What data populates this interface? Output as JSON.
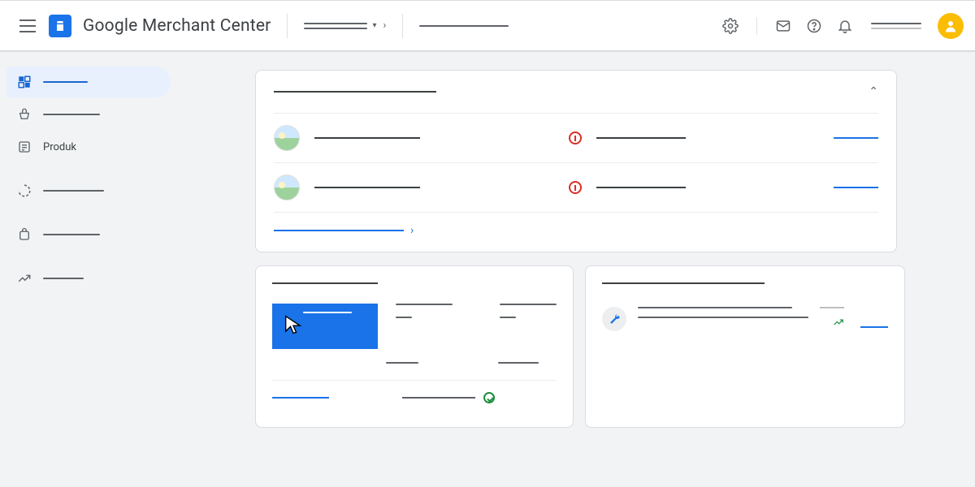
{
  "header": {
    "app_title": "Google Merchant Center",
    "account_selector": "",
    "secondary_selector": "",
    "user_label": ""
  },
  "sidebar": {
    "items": [
      {
        "id": "overview",
        "label": "",
        "active": true
      },
      {
        "id": "orders",
        "label": ""
      },
      {
        "id": "products",
        "label": "Produk"
      },
      {
        "id": "performance",
        "label": ""
      },
      {
        "id": "marketing",
        "label": ""
      },
      {
        "id": "growth",
        "label": ""
      }
    ]
  },
  "overview_card": {
    "title": "",
    "rows": [
      {
        "name": "",
        "status": "",
        "status_type": "error",
        "action": ""
      },
      {
        "name": "",
        "status": "",
        "status_type": "error",
        "action": ""
      }
    ],
    "footer_link": ""
  },
  "card_b": {
    "title": "",
    "highlighted": "",
    "footer": {
      "link": "",
      "text": "",
      "status": "approved"
    }
  },
  "card_c": {
    "title": "",
    "item": {
      "line1": "",
      "line2": "",
      "trend": "up",
      "side": "",
      "action": ""
    }
  },
  "icons": {
    "settings": "gear-icon",
    "mail": "mail-icon",
    "help": "help-icon",
    "bell": "bell-icon",
    "avatar": "user-avatar"
  },
  "colors": {
    "primary": "#1a73e8",
    "error": "#d93025",
    "success": "#1e8e3e",
    "accent": "#fbbc04"
  }
}
